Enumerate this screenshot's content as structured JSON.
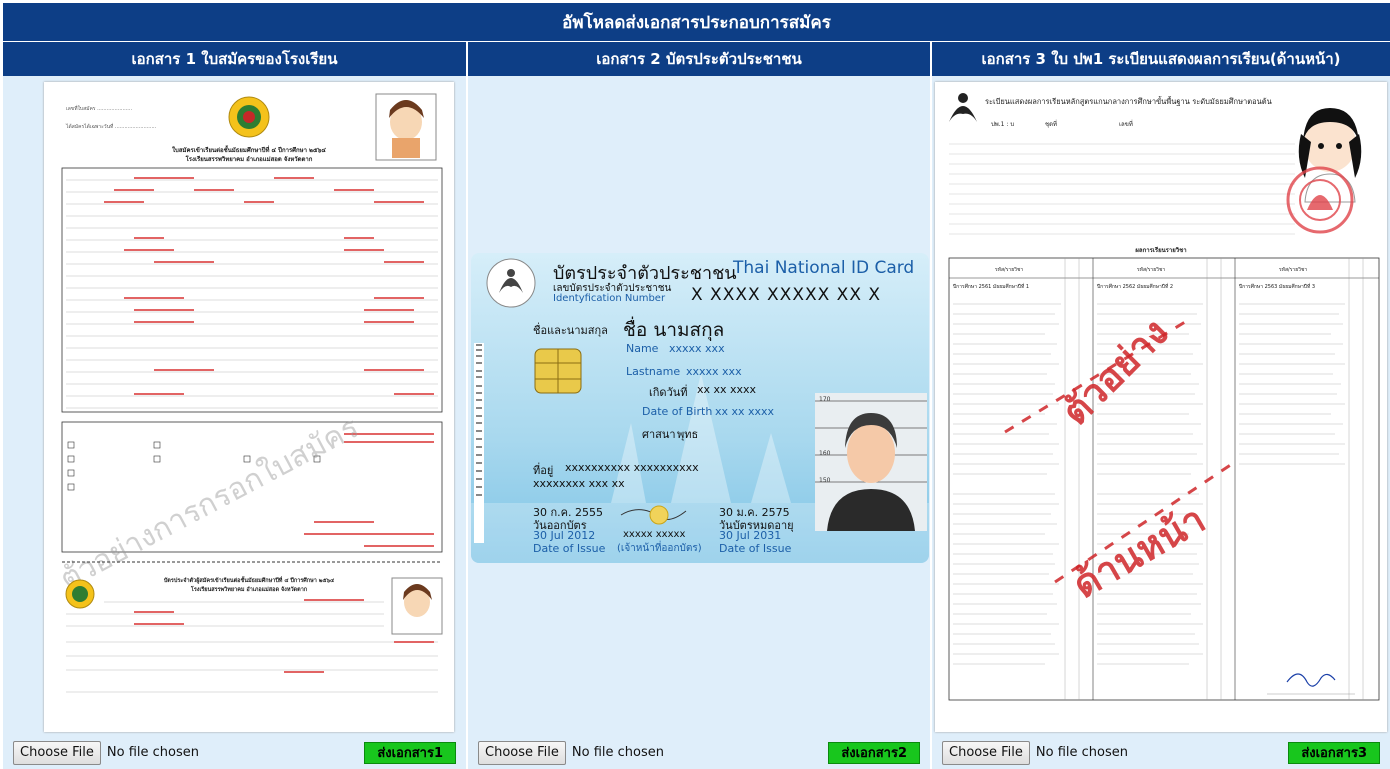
{
  "page_title": "อัพโหลดส่งเอกสารประกอบการสมัคร",
  "columns": [
    {
      "heading": "เอกสาร 1 ใบสมัครของโรงเรียน",
      "file_button": "Choose File",
      "file_status": "No file chosen",
      "send_label": "ส่งเอกสาร1"
    },
    {
      "heading": "เอกสาร 2 บัตรประตัวประชาชน",
      "file_button": "Choose File",
      "file_status": "No file chosen",
      "send_label": "ส่งเอกสาร2"
    },
    {
      "heading": "เอกสาร 3 ใบ ปพ1 ระเบียนแสดงผลการเรียน(ด้านหน้า)",
      "file_button": "Choose File",
      "file_status": "No file chosen",
      "send_label": "ส่งเอกสาร3"
    }
  ],
  "doc1": {
    "form_title": "ใบสมัครเข้าเรียนต่อชั้นมัธยมศึกษาปีที่ ๔ ปีการศึกษา ๒๕๖๔",
    "school_line": "โรงเรียนสรรพวิทยาคม อำเภอแม่สอด จังหวัดตาก",
    "watermark": "ตัวอย่างการกรอกใบสมัคร",
    "card_title": "บัตรประจำตัวผู้สมัครเข้าเรียนต่อชั้นมัธยมศึกษาปีที่ ๔ ปีการศึกษา ๒๕๖๔",
    "card_school": "โรงเรียนสรรพวิทยาคม อำเภอแม่สอด จังหวัดตาก"
  },
  "doc2": {
    "card_title_th": "บัตรประจำตัวประชาชน",
    "card_title_en": "Thai National ID Card",
    "id_label_th": "เลขบัตรประจำตัวประชาชน",
    "id_label_en": "Identyfication Number",
    "id_number": "X XXXX XXXXX XX X",
    "name_label_th": "ชื่อและนามสกุล",
    "name_value_th": "ชื่อ นามสกุล",
    "name_label_en": "Name",
    "name_value_en": "xxxxx xxx",
    "lastname_label": "Lastname",
    "lastname_value": "xxxxx xxx",
    "birth_label_th": "เกิดวันที่",
    "birth_value_th": "xx xx xxxx",
    "birth_label_en": "Date of Birth",
    "birth_value_en": "xx xx xxxx",
    "religion_label": "ศาสนา",
    "religion_value": "พุทธ",
    "address_label": "ที่อยู่",
    "address_line1": "xxxxxxxxxx xxxxxxxxxx",
    "address_line2": "xxxxxxxx xxx xx",
    "issue_date_th": "30 ก.ค. 2555",
    "issue_label_th": "วันออกบัตร",
    "issue_date_en": "30 Jul 2012",
    "issue_label_en": "Date of Issue",
    "officer_value": "xxxxx xxxxx",
    "officer_label": "(เจ้าหน้าที่ออกบัตร)",
    "expiry_date_th": "30 ม.ค. 2575",
    "expiry_label_th": "วันบัตรหมดอายุ",
    "expiry_date_en": "30 Jul 2031",
    "expiry_label_en": "Date of Issue",
    "height_ticks": [
      "170",
      "160",
      "150"
    ]
  },
  "doc3": {
    "header": "ระเบียนแสดงผลการเรียนหลักสูตรแกนกลางการศึกษาขั้นพื้นฐาน ระดับมัธยมศึกษาตอนต้น",
    "form_code": "ปพ.1 : บ",
    "set_label": "ชุดที่",
    "number_label": "เลขที่",
    "results_title": "ผลการเรียนรายวิชา",
    "col_subject": "รหัส/รายวิชา",
    "year1": "ปีการศึกษา 2561 มัธยมศึกษาปีที่ 1",
    "year2": "ปีการศึกษา 2562 มัธยมศึกษาปีที่ 2",
    "year3": "ปีการศึกษา 2563 มัธยมศึกษาปีที่ 3",
    "stamp_sample": "ตัวอย่าง",
    "stamp_front": "ด้านหน้า"
  },
  "colors": {
    "header_blue": "#0d3e86",
    "panel_bg": "#dfeefa",
    "send_green": "#18c61d",
    "red_text": "#c2171b"
  }
}
